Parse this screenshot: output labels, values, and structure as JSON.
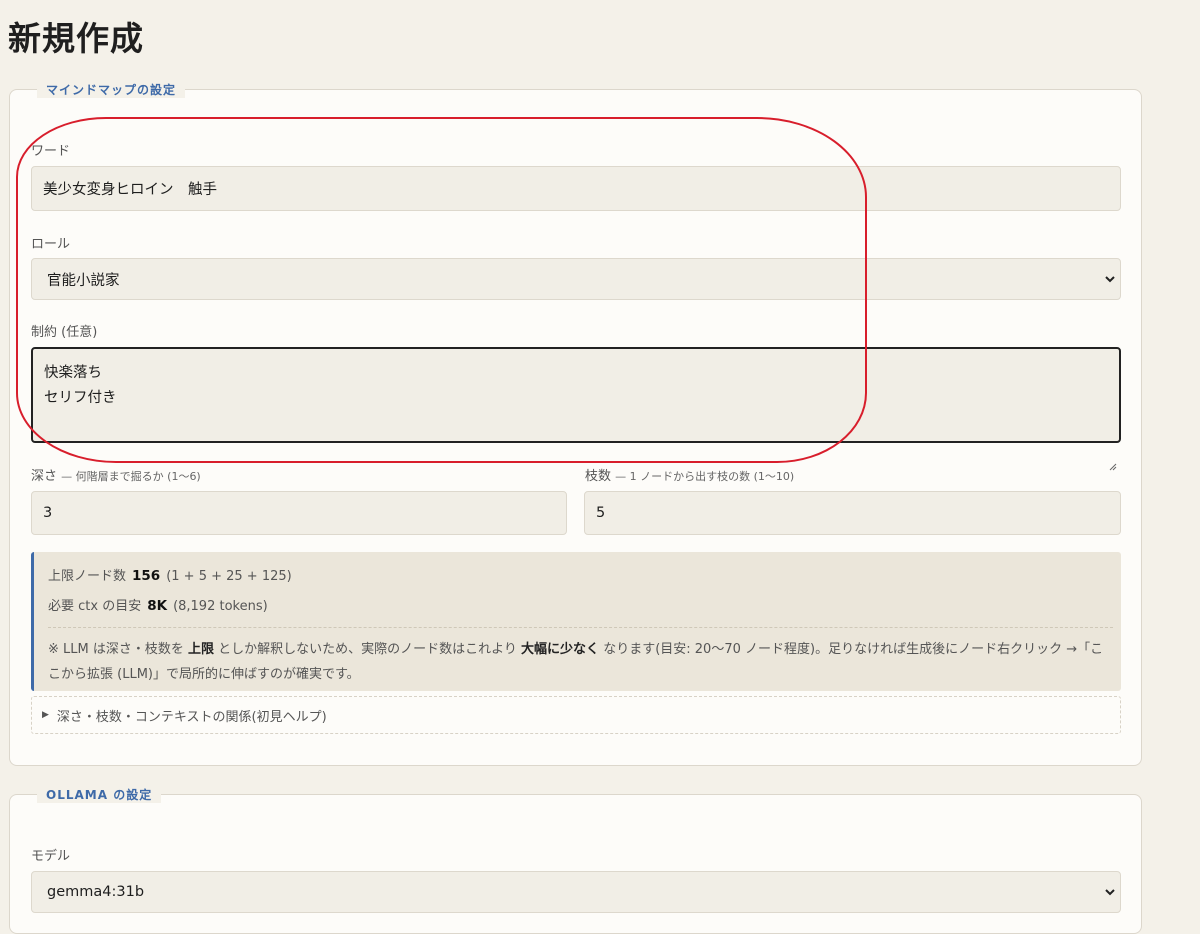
{
  "page": {
    "title": "新規作成"
  },
  "mindmap_section": {
    "legend": "マインドマップの設定",
    "word_label": "ワード",
    "word_value": "美少女変身ヒロイン　触手",
    "role_label": "ロール",
    "role_value": "官能小説家",
    "constraint_label": "制約 (任意)",
    "constraint_value": "快楽落ち\nセリフ付き",
    "depth_label": "深さ",
    "depth_hint": "— 何階層まで掘るか (1〜6)",
    "depth_value": "3",
    "branch_label": "枝数",
    "branch_hint": "— 1 ノードから出す枝の数 (1〜10)",
    "branch_value": "5",
    "info": {
      "max_nodes_label": "上限ノード数",
      "max_nodes_value": "156",
      "max_nodes_formula": "(1 + 5 + 25 + 125)",
      "ctx_label": "必要 ctx の目安",
      "ctx_value": "8K",
      "ctx_tokens": "(8,192 tokens)",
      "note_prefix": "※ LLM は深さ・枝数を",
      "note_bold1": "上限",
      "note_mid": "としか解釈しないため、実際のノード数はこれより",
      "note_bold2": "大幅に少なく",
      "note_suffix": "なります(目安: 20〜70 ノード程度)。足りなければ生成後にノード右クリック →「ここから拡張 (LLM)」で局所的に伸ばすのが確実です。"
    },
    "help_summary": "深さ・枝数・コンテキストの関係(初見ヘルプ)"
  },
  "ollama_section": {
    "legend": "OLLAMA の設定",
    "model_label": "モデル",
    "model_value": "gemma4:31b"
  },
  "colors": {
    "background": "#f4f1e9",
    "accent": "#3e6aa8",
    "annotation": "#d81e2c"
  }
}
